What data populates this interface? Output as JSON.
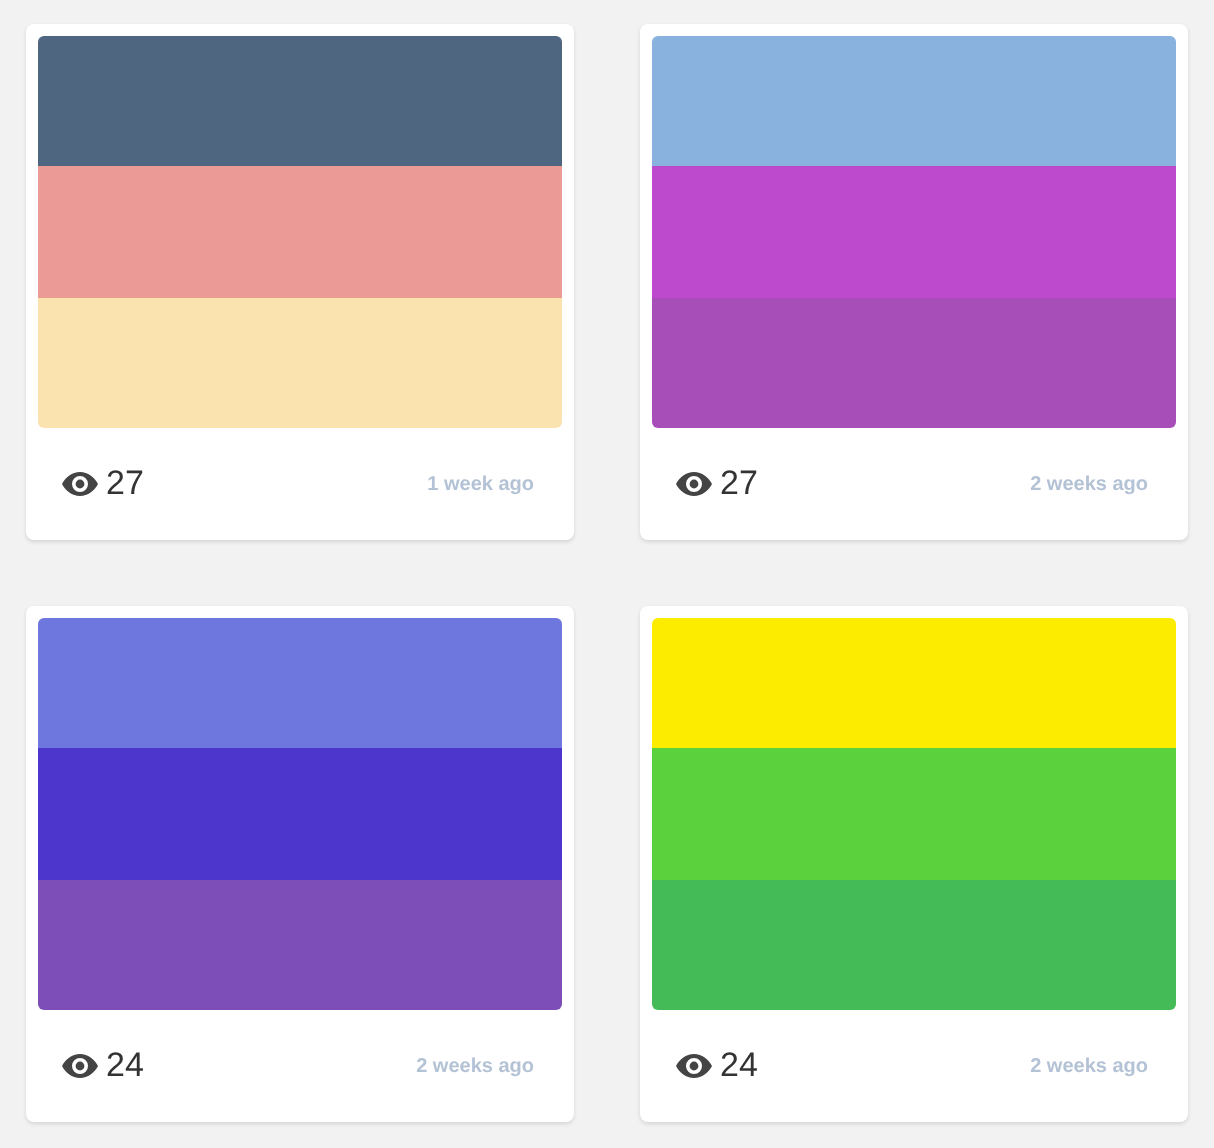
{
  "palettes": [
    {
      "swatches": [
        {
          "color": "#4f6680"
        },
        {
          "color": "#ec9a95"
        },
        {
          "color": "#fbe3b0"
        }
      ],
      "views": "27",
      "age": "1 week ago"
    },
    {
      "swatches": [
        {
          "color": "#89b3de"
        },
        {
          "color": "#bd4acc"
        },
        {
          "color": "#a84eb8"
        }
      ],
      "views": "27",
      "age": "2 weeks ago"
    },
    {
      "swatches": [
        {
          "color": "#6e77dd"
        },
        {
          "color": "#4c36cc"
        },
        {
          "color": "#7d4eb8"
        }
      ],
      "views": "24",
      "age": "2 weeks ago"
    },
    {
      "swatches": [
        {
          "color": "#fbec00"
        },
        {
          "color": "#5cd13e"
        },
        {
          "color": "#44bb57"
        }
      ],
      "views": "24",
      "age": "2 weeks ago"
    }
  ]
}
